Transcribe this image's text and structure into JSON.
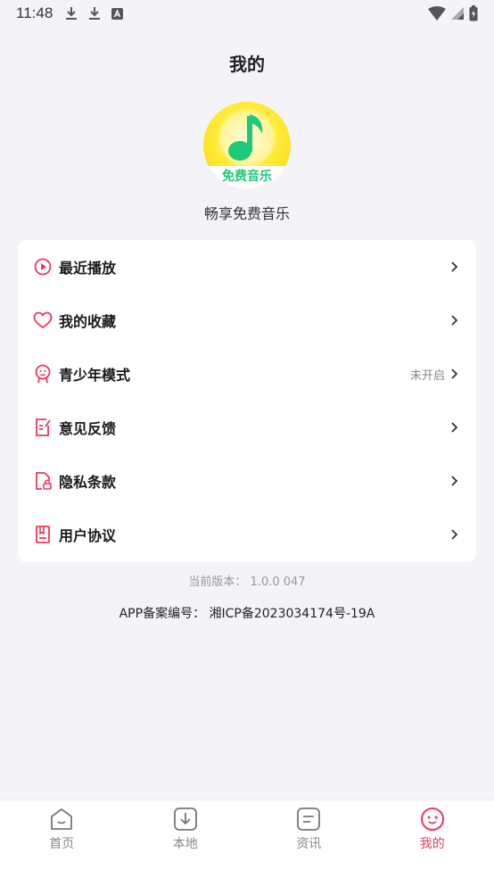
{
  "status_bar": {
    "time": "11:48"
  },
  "header": {
    "title": "我的"
  },
  "app": {
    "logo_text": "免费音乐",
    "slogan": "畅享免费音乐"
  },
  "menu": {
    "items": [
      {
        "label": "最近播放",
        "icon": "play-circle-icon",
        "status": ""
      },
      {
        "label": "我的收藏",
        "icon": "heart-icon",
        "status": ""
      },
      {
        "label": "青少年模式",
        "icon": "teen-mode-icon",
        "status": "未开启"
      },
      {
        "label": "意见反馈",
        "icon": "feedback-icon",
        "status": ""
      },
      {
        "label": "隐私条款",
        "icon": "privacy-doc-icon",
        "status": ""
      },
      {
        "label": "用户协议",
        "icon": "agreement-icon",
        "status": ""
      }
    ]
  },
  "footer": {
    "version": "当前版本：  1.0.0 047",
    "icp": "APP备案编号：  湘ICP备2023034174号-19A"
  },
  "tabs": [
    {
      "label": "首页",
      "icon": "home-icon",
      "active": false
    },
    {
      "label": "本地",
      "icon": "download-icon",
      "active": false
    },
    {
      "label": "资讯",
      "icon": "news-icon",
      "active": false
    },
    {
      "label": "我的",
      "icon": "profile-face-icon",
      "active": true
    }
  ],
  "colors": {
    "accent": "#f0385a",
    "background": "#f4f4f8",
    "logo_yellow": "#ffeb3b",
    "logo_green": "#1ec977"
  }
}
